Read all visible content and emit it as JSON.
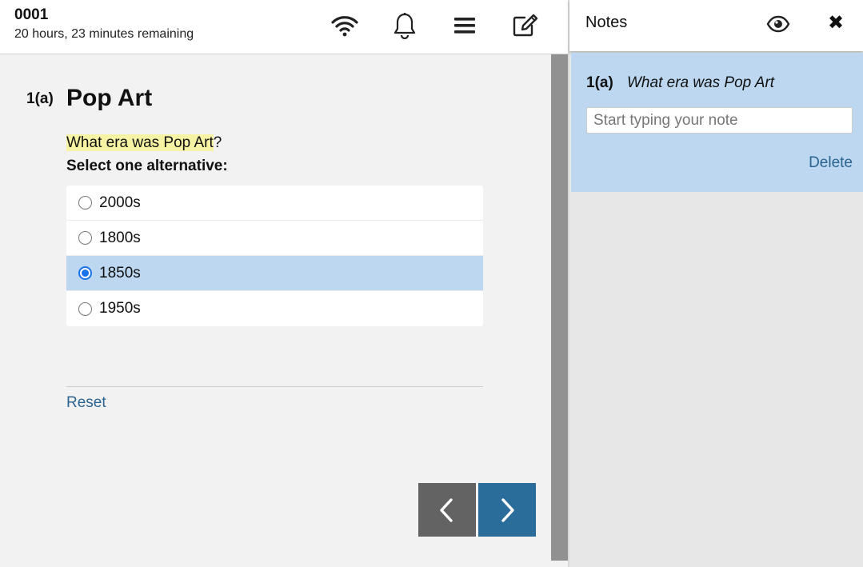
{
  "header": {
    "candidate_id": "0001",
    "time_remaining": "20 hours, 23 minutes remaining",
    "icons": [
      "wifi-icon",
      "bell-icon",
      "menu-icon",
      "edit-icon"
    ]
  },
  "question": {
    "number": "1(a)",
    "title": "Pop Art",
    "text_highlight": "What era was Pop Art",
    "text_rest": "?",
    "instruction": "Select one alternative:",
    "options": [
      {
        "label": "2000s",
        "selected": false
      },
      {
        "label": "1800s",
        "selected": false
      },
      {
        "label": "1850s",
        "selected": true
      },
      {
        "label": "1950s",
        "selected": false
      }
    ],
    "reset_label": "Reset"
  },
  "notes": {
    "title": "Notes",
    "note_number": "1(a)",
    "note_question": "What era was Pop Art",
    "input_value": "",
    "input_placeholder": "Start typing your note",
    "delete_label": "Delete"
  },
  "colors": {
    "selected_bg": "#bcd7ef",
    "highlight": "#f6f3a4",
    "link": "#2b6491",
    "next_button": "#2b6d9a",
    "prev_button": "#636363"
  }
}
